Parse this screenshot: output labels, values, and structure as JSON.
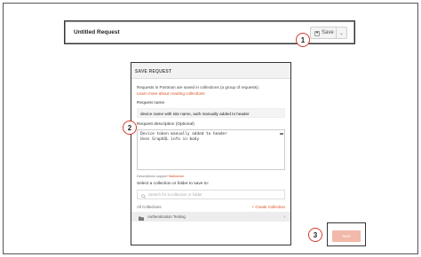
{
  "request_bar": {
    "title": "Untitled Request",
    "save_label": "Save",
    "save_icon": "save-icon",
    "dropdown_icon": "chevron-down-icon"
  },
  "callouts": [
    "1",
    "2",
    "3"
  ],
  "modal": {
    "header": "SAVE REQUEST",
    "info_text": "Requests in Postman are saved in collections (a group of requests).",
    "info_link": "Learn more about creating collections",
    "name_label": "Request name",
    "name_value": "device name with site name, auth manually added to header",
    "description_label": "Request description (Optional)",
    "description_lines": [
      "Device token manually added to header",
      "Uses GraphQL info in body"
    ],
    "markdown_prefix": "Descriptions support",
    "markdown_link": "Markdown",
    "select_label": "Select a collection or folder to save to:",
    "search_placeholder": "Search for a collection or folder",
    "collections_title": "All Collections",
    "create_collection": "+ Create Collection",
    "collection_items": [
      {
        "label": "Authentication Testing",
        "icon": "folder-icon"
      }
    ]
  },
  "bottom_save": {
    "label": "Save"
  },
  "colors": {
    "accent": "#d84f1e",
    "callout_ring": "#d23b2e",
    "save_disabled": "#f2b8a9"
  }
}
